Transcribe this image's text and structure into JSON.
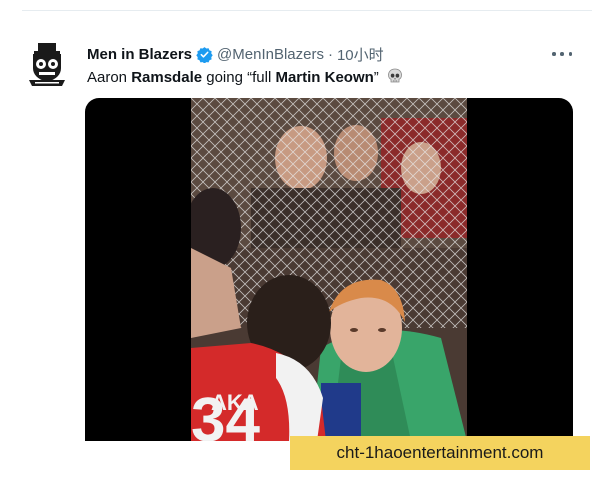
{
  "tweet": {
    "display_name": "Men in Blazers",
    "handle": "@MenInBlazers",
    "separator": "·",
    "time": "10小时",
    "text_parts": [
      "Aaron ",
      "Ramsdale",
      " going “full ",
      "Martin Keown",
      "”"
    ],
    "emoji": "skull-icon"
  },
  "media": {
    "jersey_text": "AKA",
    "jersey_number": "34"
  },
  "watermark": {
    "text": "cht-1haoentertainment.com"
  },
  "colors": {
    "verified_blue": "#1d9bf0",
    "text_primary": "#0f1419",
    "text_secondary": "#536471",
    "watermark_bg": "#f4d35e"
  }
}
